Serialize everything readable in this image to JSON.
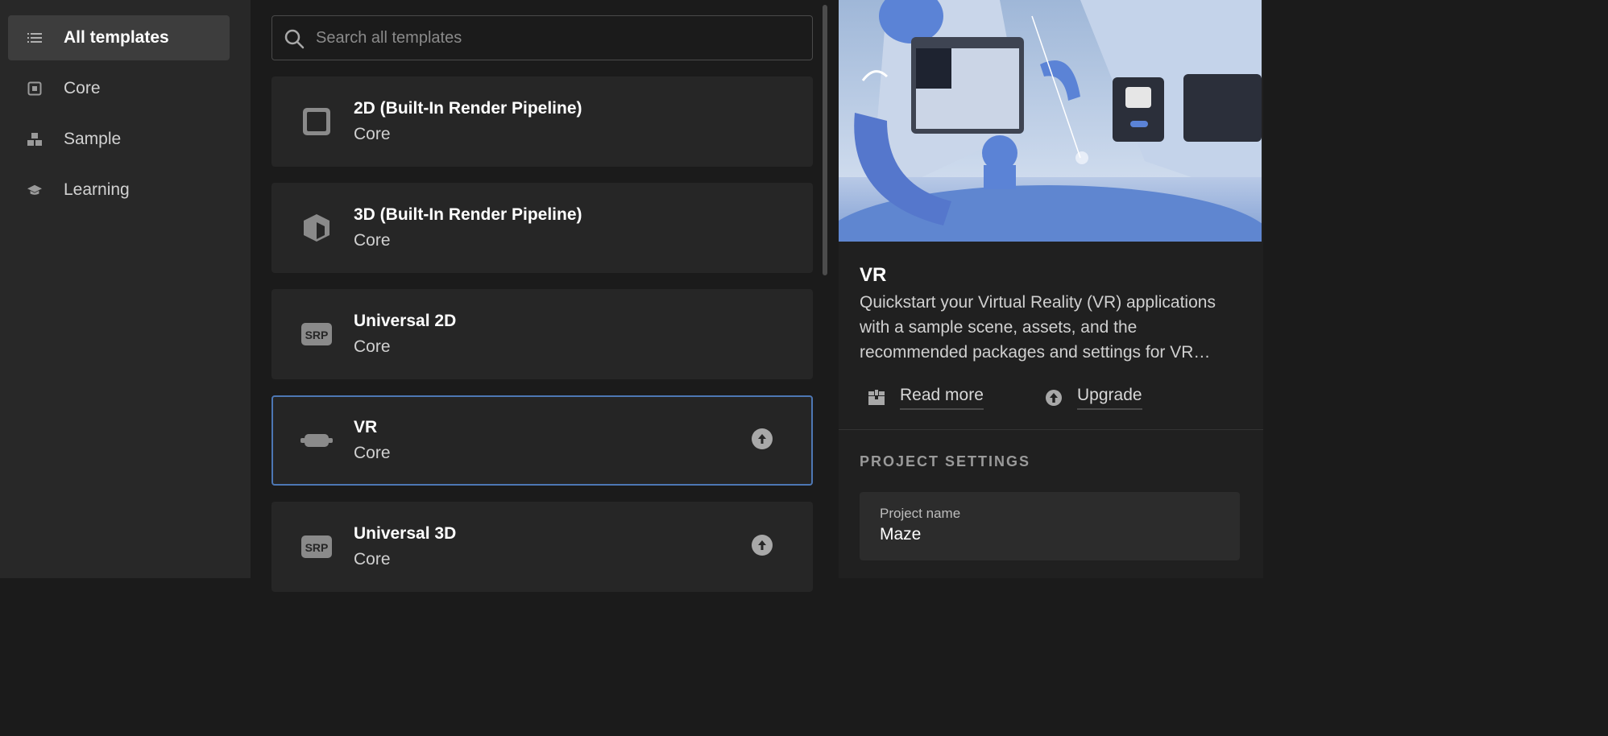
{
  "sidebar": {
    "items": [
      {
        "label": "All templates",
        "icon": "list-icon",
        "active": true
      },
      {
        "label": "Core",
        "icon": "square-dot-icon",
        "active": false
      },
      {
        "label": "Sample",
        "icon": "blocks-icon",
        "active": false
      },
      {
        "label": "Learning",
        "icon": "graduation-cap-icon",
        "active": false
      }
    ]
  },
  "search": {
    "placeholder": "Search all templates",
    "value": ""
  },
  "templates": [
    {
      "title": "2D (Built-In Render Pipeline)",
      "category": "Core",
      "icon": "square-2d-icon",
      "upgrade": false,
      "selected": false
    },
    {
      "title": "3D (Built-In Render Pipeline)",
      "category": "Core",
      "icon": "cube-icon",
      "upgrade": false,
      "selected": false
    },
    {
      "title": "Universal 2D",
      "category": "Core",
      "icon": "srp-icon",
      "icon_text": "SRP",
      "upgrade": false,
      "selected": false
    },
    {
      "title": "VR",
      "category": "Core",
      "icon": "vr-headset-icon",
      "upgrade": true,
      "selected": true
    },
    {
      "title": "Universal 3D",
      "category": "Core",
      "icon": "srp-icon",
      "icon_text": "SRP",
      "upgrade": true,
      "selected": false
    }
  ],
  "detail": {
    "title": "VR",
    "description": "Quickstart your Virtual Reality (VR) applications with a sample scene, assets, and the recommended packages and settings for VR development.",
    "read_more_label": "Read more",
    "upgrade_label": "Upgrade"
  },
  "project_settings": {
    "heading": "PROJECT SETTINGS",
    "name_label": "Project name",
    "name_value": "Maze"
  },
  "colors": {
    "selection_border": "#4d77b4",
    "background": "#1b1b1b",
    "panel": "#262626"
  }
}
